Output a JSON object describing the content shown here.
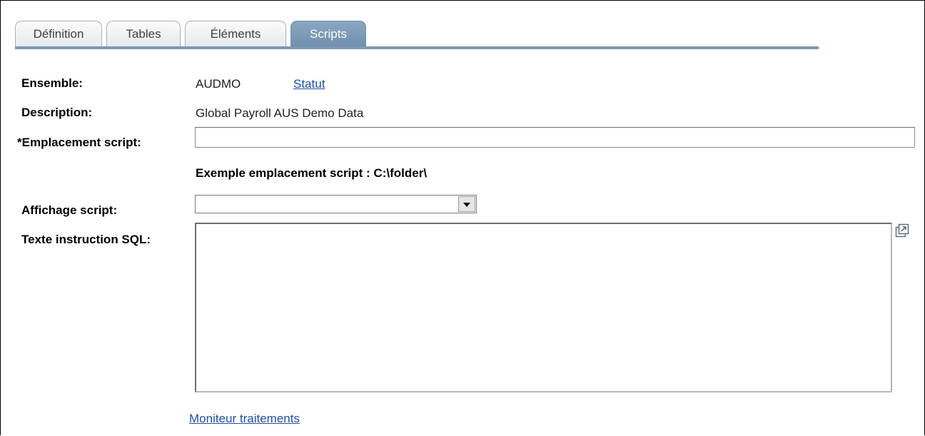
{
  "tabs": [
    {
      "label": "Définition"
    },
    {
      "label": "Tables"
    },
    {
      "label": "Éléments"
    },
    {
      "label": "Scripts"
    }
  ],
  "active_tab": "Scripts",
  "fields": {
    "ensemble_label": "Ensemble:",
    "ensemble_value": "AUDMO",
    "statut_link": "Statut",
    "description_label": "Description:",
    "description_value": "Global Payroll AUS Demo Data",
    "emplacement_label": "*Emplacement script:",
    "emplacement_value": "",
    "example_text": "Exemple emplacement script : C:\\folder\\",
    "affichage_label": "Affichage script:",
    "affichage_selected": "",
    "sql_label": "Texte instruction SQL:",
    "sql_value": ""
  },
  "footer": {
    "moniteur_link": "Moniteur traitements"
  },
  "icons": [
    "dropdown-arrow-icon",
    "expand-window-icon"
  ]
}
